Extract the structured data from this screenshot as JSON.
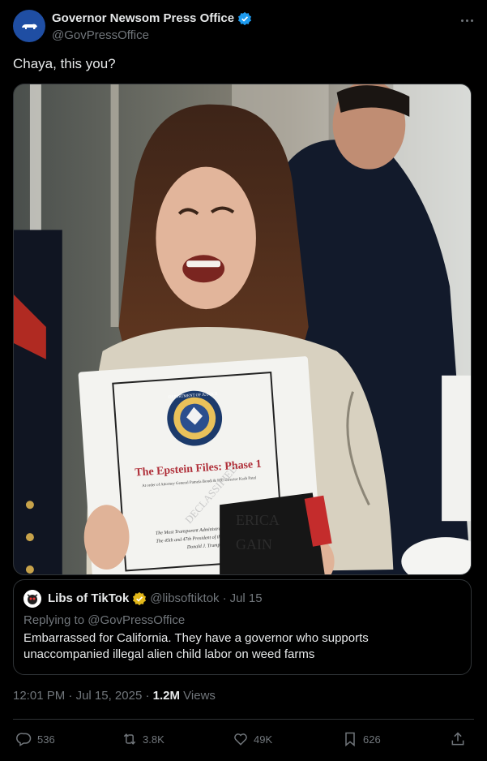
{
  "author": {
    "display_name": "Governor Newsom Press Office",
    "handle": "@GovPressOffice",
    "verified_icon": "verified-badge-icon",
    "avatar_icon": "california-bear-icon"
  },
  "tweet": {
    "text": "Chaya, this you?"
  },
  "media": {
    "binder_title": "The Epstein Files: Phase 1",
    "binder_subtitle": "At order of Attorney General Pamela Bondi & FBI Director Kash Patel",
    "binder_stamp": "DECLASSIFIED",
    "binder_footer_1": "The Most Transparent Administration In History",
    "binder_footer_2": "The 45th and 47th President of the United States",
    "binder_footer_3": "Donald J. Trump",
    "seal_text": "DEPARTMENT OF JUSTICE",
    "hat_text_1": "ERICA",
    "hat_text_2": "GAIN"
  },
  "quote": {
    "display_name": "Libs of TikTok",
    "handle": "@libsoftiktok",
    "separator": "·",
    "date": "Jul 15",
    "reply_to": "Replying to @GovPressOffice",
    "text": "Embarrassed for California. They have a governor who supports unaccompanied illegal alien child labor on weed farms"
  },
  "meta": {
    "time": "12:01 PM",
    "sep1": "·",
    "date": "Jul 15, 2025",
    "sep2": "·",
    "views_count": "1.2M",
    "views_label": "Views"
  },
  "actions": {
    "replies": "536",
    "reposts": "3.8K",
    "likes": "49K",
    "bookmarks": "626"
  },
  "colors": {
    "background": "#000000",
    "text_primary": "#e7e9ea",
    "text_secondary": "#71767b",
    "border": "#2f3336",
    "verified_blue": "#1d9bf0",
    "verified_gold": "#e2b719"
  }
}
